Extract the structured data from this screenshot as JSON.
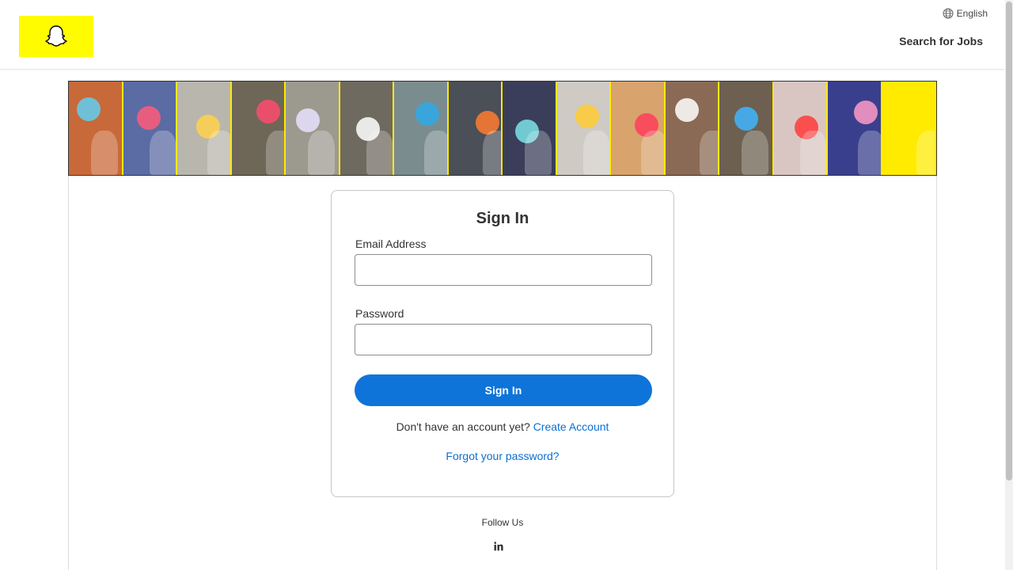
{
  "header": {
    "language": "English",
    "jobs_link": "Search for Jobs"
  },
  "banner": {
    "tiles": [
      {
        "bg": "#c8693a",
        "accent": "#5fd0f2"
      },
      {
        "bg": "#5b6ba3",
        "accent": "#ff5a7a"
      },
      {
        "bg": "#b9b6ad",
        "accent": "#ffd24a"
      },
      {
        "bg": "#6e6656",
        "accent": "#ff4b6e"
      },
      {
        "bg": "#9c9a8f",
        "accent": "#e9e2ff"
      },
      {
        "bg": "#6f6a60",
        "accent": "#ffffff"
      },
      {
        "bg": "#7b8c8f",
        "accent": "#2fa9e8"
      },
      {
        "bg": "#4b4f57",
        "accent": "#ff7b2e"
      },
      {
        "bg": "#3b3e5a",
        "accent": "#7be3e8"
      },
      {
        "bg": "#cfcac4",
        "accent": "#ffcc33"
      },
      {
        "bg": "#d8a36d",
        "accent": "#ff3d5a"
      },
      {
        "bg": "#8a6a55",
        "accent": "#ffffff"
      },
      {
        "bg": "#6d6050",
        "accent": "#3fb6ff"
      },
      {
        "bg": "#d9c6c2",
        "accent": "#ff3a3a"
      },
      {
        "bg": "#3a3f8d",
        "accent": "#ff9bc7"
      },
      {
        "bg": "#FFEB00",
        "accent": "#FFEB00"
      }
    ]
  },
  "signin": {
    "title": "Sign In",
    "email_label": "Email Address",
    "email_value": "",
    "password_label": "Password",
    "password_value": "",
    "submit_label": "Sign In",
    "no_account_text": "Don't have an account yet?",
    "create_account_link": "Create Account",
    "forgot_link": "Forgot your password?"
  },
  "footer": {
    "follow_text": "Follow Us",
    "social_icon": "linkedin-icon"
  },
  "colors": {
    "snap_yellow": "#FFFC00",
    "primary_button": "#0e74d9",
    "link": "#0b6fd1"
  }
}
